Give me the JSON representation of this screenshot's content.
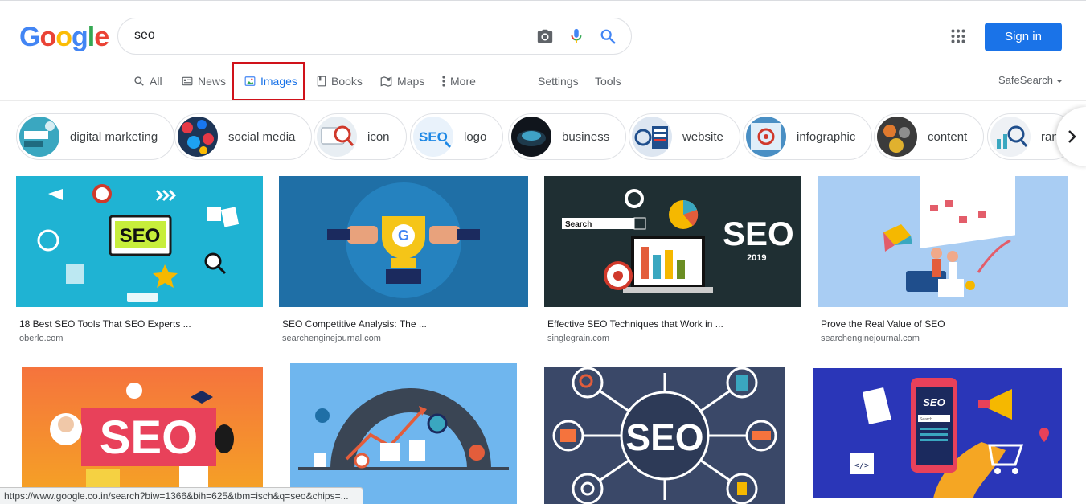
{
  "logo": {
    "letters": [
      "G",
      "o",
      "o",
      "g",
      "l",
      "e"
    ]
  },
  "search": {
    "value": "seo",
    "placeholder": ""
  },
  "header": {
    "signin_label": "Sign in"
  },
  "tabs": [
    {
      "label": "All"
    },
    {
      "label": "News"
    },
    {
      "label": "Images"
    },
    {
      "label": "Books"
    },
    {
      "label": "Maps"
    },
    {
      "label": "More"
    },
    {
      "label": "Settings"
    },
    {
      "label": "Tools"
    }
  ],
  "safesearch": "SafeSearch",
  "chips": [
    {
      "label": "digital marketing",
      "thumb_color": "#3aa7c0"
    },
    {
      "label": "social media",
      "thumb_color": "#c0392b"
    },
    {
      "label": "icon",
      "thumb_color": "#e8eef3"
    },
    {
      "label": "logo",
      "thumb_color": "#e9f2fb"
    },
    {
      "label": "business",
      "thumb_color": "#10151c"
    },
    {
      "label": "website",
      "thumb_color": "#dde6f1"
    },
    {
      "label": "infographic",
      "thumb_color": "#4a8fc4"
    },
    {
      "label": "content",
      "thumb_color": "#3b3b3b"
    },
    {
      "label": "ran",
      "thumb_color": "#eef1f5"
    }
  ],
  "results": [
    {
      "title": "18 Best SEO Tools That SEO Experts ...",
      "source": "oberlo.com",
      "bg": "#1fb3d3",
      "image_text": "SEO"
    },
    {
      "title": "SEO Competitive Analysis: The ...",
      "source": "searchenginejournal.com",
      "bg": "#1f6fa6"
    },
    {
      "title": "Effective SEO Techniques that Work in ...",
      "source": "singlegrain.com",
      "bg": "#1f2f33",
      "image_text": "SEO",
      "image_subtext": "2019",
      "image_search_label": "Search"
    },
    {
      "title": "Prove the Real Value of SEO",
      "source": "searchenginejournal.com",
      "bg": "#a9cdf3"
    },
    {
      "bg": "#f5733d",
      "image_text": "SEO"
    },
    {
      "bg": "#6fb6ee"
    },
    {
      "bg": "#3a4868",
      "image_text": "SEO"
    },
    {
      "bg": "#2a36b8",
      "image_text": "SEO",
      "image_search_label": "Search"
    }
  ],
  "status_url": "https://www.google.co.in/search?biw=1366&bih=625&tbm=isch&q=seo&chips=..."
}
